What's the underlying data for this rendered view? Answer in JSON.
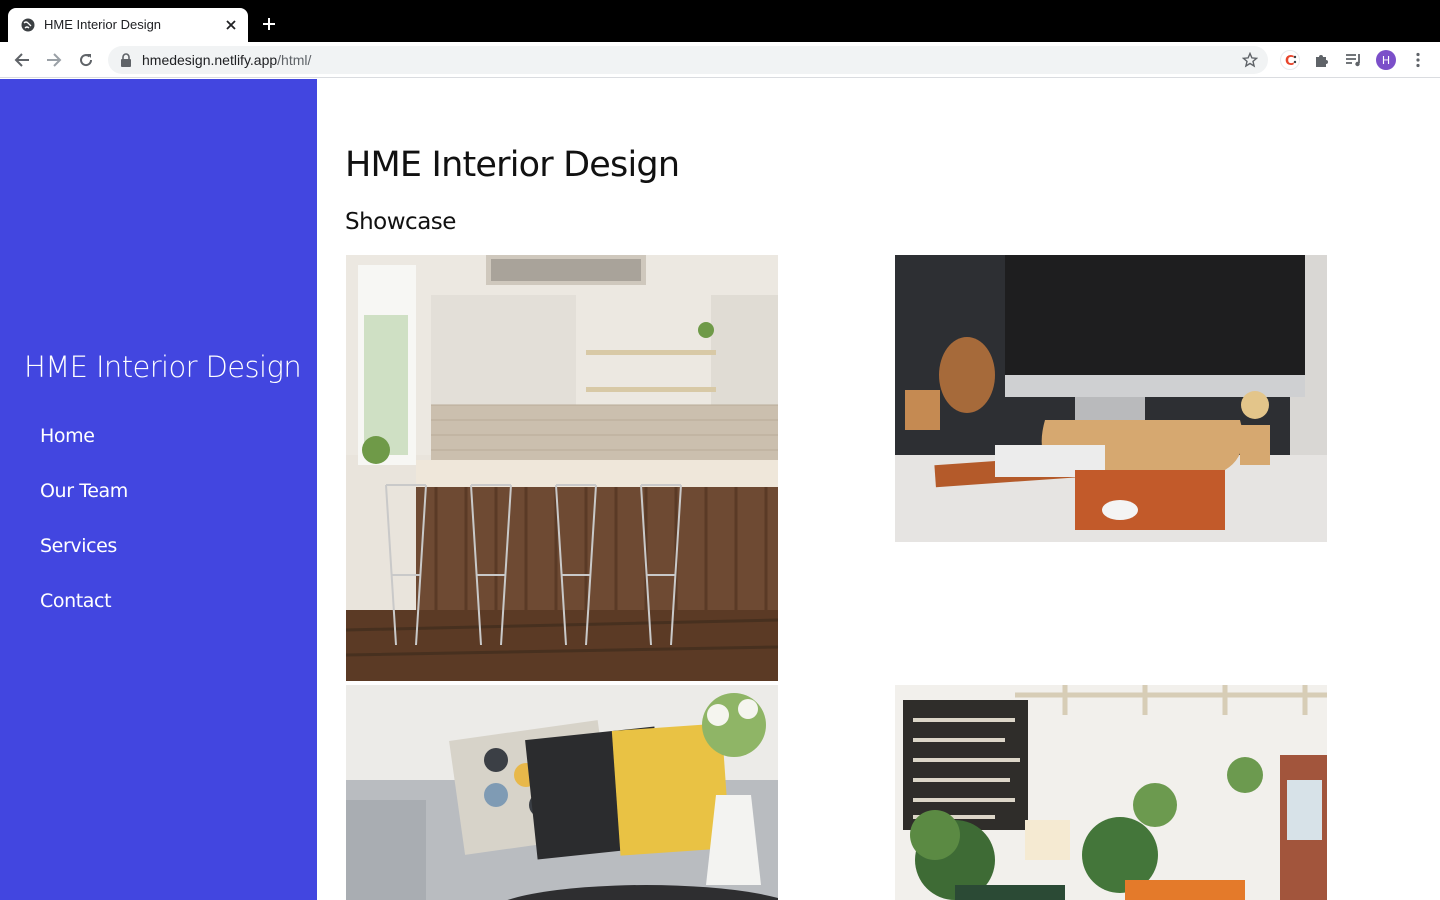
{
  "browser": {
    "tab_title": "HME Interior Design",
    "url_host": "hmedesign.netlify.app",
    "url_path": "/html/",
    "avatar_letter": "H",
    "icons": [
      "globe-icon",
      "close-icon",
      "plus-icon",
      "back-icon",
      "forward-icon",
      "reload-icon",
      "lock-icon",
      "star-icon",
      "extension-c-icon",
      "puzzle-icon",
      "media-queue-icon",
      "kebab-menu-icon"
    ]
  },
  "sidebar": {
    "brand": "HME Interior Design",
    "bg_color": "#4246e0",
    "nav": [
      {
        "label": "Home"
      },
      {
        "label": "Our Team"
      },
      {
        "label": "Services"
      },
      {
        "label": "Contact"
      }
    ]
  },
  "main": {
    "title": "HME Interior Design",
    "section": "Showcase",
    "photos": [
      {
        "name": "kitchen-photo"
      },
      {
        "name": "desk-setup-photo"
      },
      {
        "name": "living-room-sofa-photo"
      },
      {
        "name": "plant-studio-photo"
      }
    ]
  }
}
